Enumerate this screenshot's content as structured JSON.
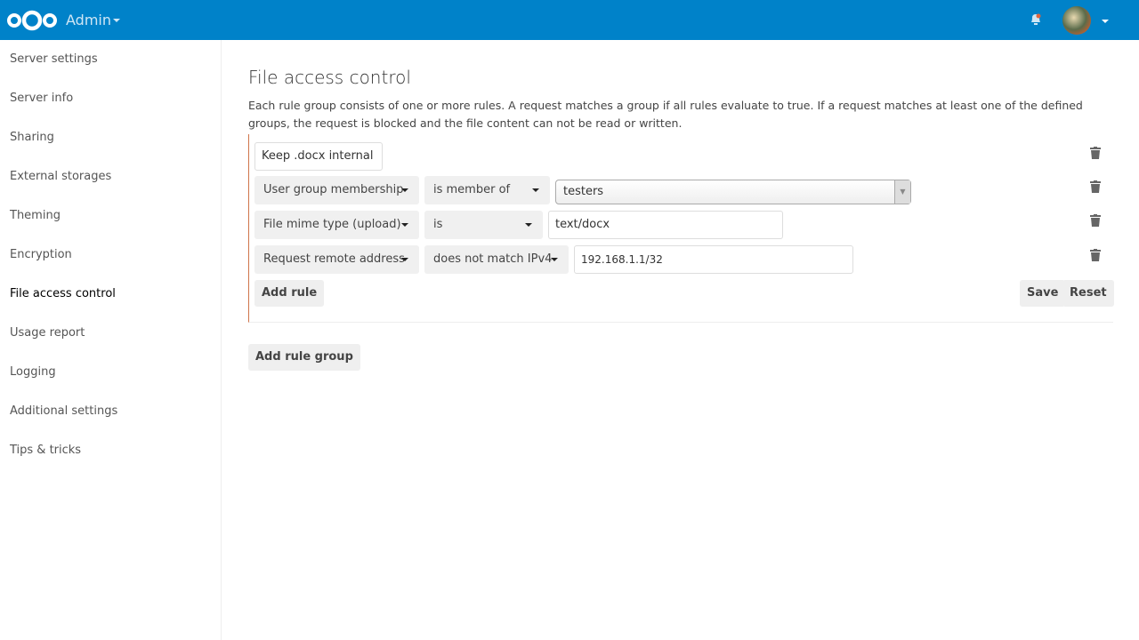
{
  "header": {
    "app_name": "Admin",
    "brand_color": "#0082c9"
  },
  "sidebar": {
    "items": [
      {
        "label": "Server settings"
      },
      {
        "label": "Server info"
      },
      {
        "label": "Sharing"
      },
      {
        "label": "External storages"
      },
      {
        "label": "Theming"
      },
      {
        "label": "Encryption"
      },
      {
        "label": "File access control",
        "active": true
      },
      {
        "label": "Usage report"
      },
      {
        "label": "Logging"
      },
      {
        "label": "Additional settings"
      },
      {
        "label": "Tips & tricks"
      }
    ]
  },
  "main": {
    "title": "File access control",
    "description": "Each rule group consists of one or more rules. A request matches a group if all rules evaluate to true. If a request matches at least one of the defined groups, the request is blocked and the file content can not be read or written.",
    "group": {
      "name": "Keep .docx internal",
      "rules": [
        {
          "check": "User group membership",
          "operator": "is member of",
          "value": "testers"
        },
        {
          "check": "File mime type (upload)",
          "operator": "is",
          "value": "text/docx"
        },
        {
          "check": "Request remote address",
          "operator": "does not match IPv4",
          "value": "192.168.1.1/32"
        }
      ],
      "add_rule": "Add rule",
      "save": "Save",
      "reset": "Reset"
    },
    "add_rule_group": "Add rule group"
  }
}
